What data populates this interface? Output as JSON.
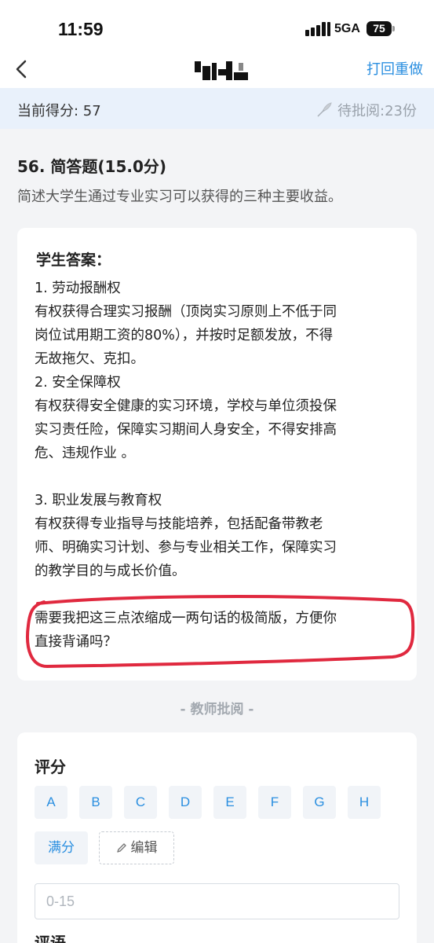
{
  "status_bar": {
    "time": "11:59",
    "network": "5GA",
    "battery": "75"
  },
  "nav": {
    "action_label": "打回重做"
  },
  "score_bar": {
    "current_score": "当前得分: 57",
    "pending": "待批阅:23份"
  },
  "question": {
    "title": "56. 简答题(15.0分)",
    "body": "简述大学生通过专业实习可以获得的三种主要收益。"
  },
  "answer": {
    "heading": "学生答案：",
    "lines": [
      "1. 劳动报酬权",
      "有权获得合理实习报酬（顶岗实习原则上不低于同",
      "岗位试用期工资的80%），并按时足额发放，不得",
      "无故拖欠、克扣。",
      " 2. 安全保障权",
      "有权获得安全健康的实习环境，学校与单位须投保",
      "实习责任险，保障实习期间人身安全，不得安排高",
      "危、违规作业 。",
      "",
      "3. 职业发展与教育权",
      "有权获得专业指导与技能培养，包括配备带教老",
      "师、明确实习计划、参与专业相关工作，保障实习",
      "的教学目的与成长价值。",
      "",
      "需要我把这三点浓缩成一两句话的极简版，方便你",
      "直接背诵吗？"
    ]
  },
  "teacher": {
    "divider": "- 教师批阅 -",
    "grade_heading": "评分",
    "grades": [
      "A",
      "B",
      "C",
      "D",
      "E",
      "F",
      "G",
      "H"
    ],
    "full_score": "满分",
    "edit": "编辑",
    "score_placeholder": "0-15",
    "comment_heading": "评语"
  },
  "colors": {
    "accent": "#2b8fe0",
    "highlight_annotation": "#e0293f"
  }
}
